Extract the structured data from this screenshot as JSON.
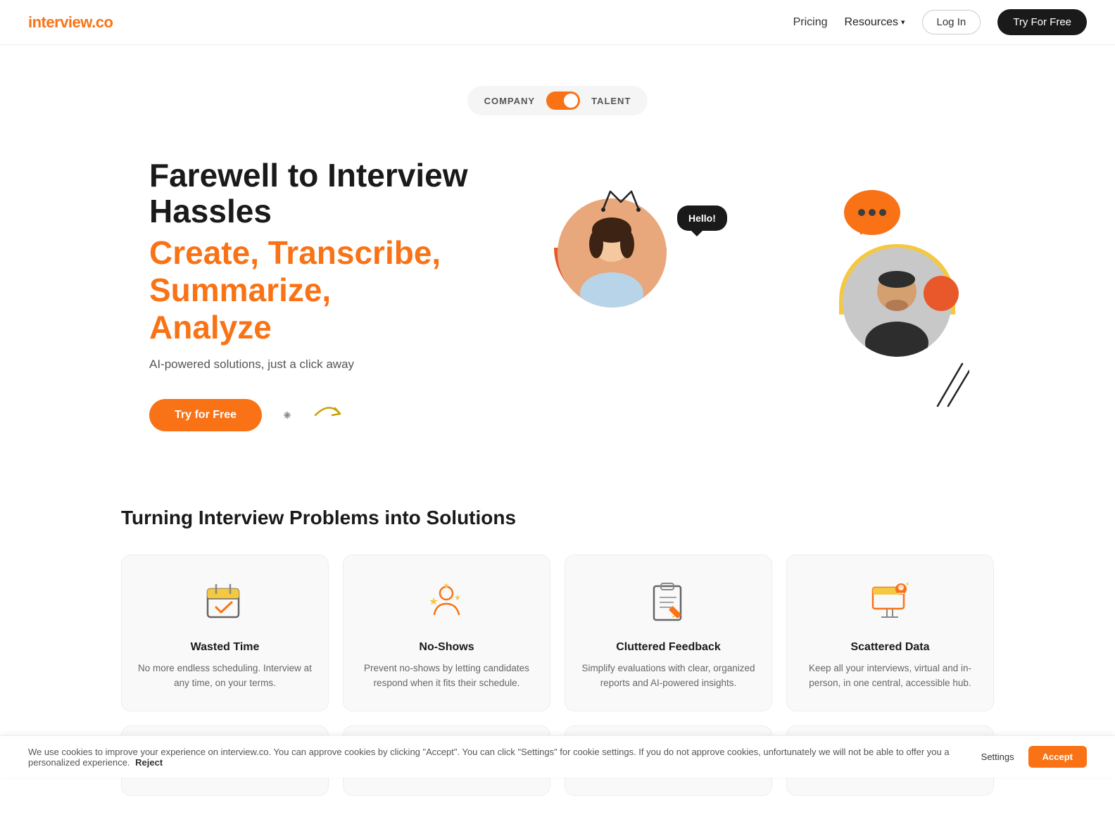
{
  "nav": {
    "logo_inter": "inter",
    "logo_view": "view",
    "logo_dot": ".",
    "logo_co": "co",
    "pricing_label": "Pricing",
    "resources_label": "Resources",
    "login_label": "Log In",
    "try_free_label": "Try For Free"
  },
  "toggle": {
    "company_label": "COMPANY",
    "talent_label": "TALENT"
  },
  "hero": {
    "title_line1": "Farewell to Interview Hassles",
    "title_line2": "Create, Transcribe, Summarize,",
    "title_line3": "Analyze",
    "desc": "AI-powered solutions, just a click away",
    "cta_label": "Try for Free",
    "speech_hello": "Hello!"
  },
  "problems": {
    "section_title": "Turning Interview Problems into Solutions",
    "cards": [
      {
        "title": "Wasted Time",
        "desc": "No more endless scheduling. Interview at any time, on your terms."
      },
      {
        "title": "No-Shows",
        "desc": "Prevent no-shows by letting candidates respond when it fits their schedule."
      },
      {
        "title": "Cluttered Feedback",
        "desc": "Simplify evaluations with clear, organized reports and AI-powered insights."
      },
      {
        "title": "Scattered Data",
        "desc": "Keep all your interviews, virtual and in-person, in one central, accessible hub."
      }
    ],
    "row2_cards": [
      {
        "title": ""
      },
      {
        "title": ""
      },
      {
        "title": ""
      },
      {
        "title": ""
      }
    ]
  },
  "cookie": {
    "text": "We use cookies to improve your experience on interview.co. You can approve cookies by clicking \"Accept\". You can click \"Settings\" for cookie settings. If you do not approve cookies, unfortunately we will not be able to offer you a personalized experience.",
    "reject_label": "Reject",
    "settings_label": "Settings",
    "accept_label": "Accept"
  },
  "colors": {
    "orange": "#f97316",
    "dark": "#1a1a1a",
    "light_bg": "#f9f9f9"
  }
}
